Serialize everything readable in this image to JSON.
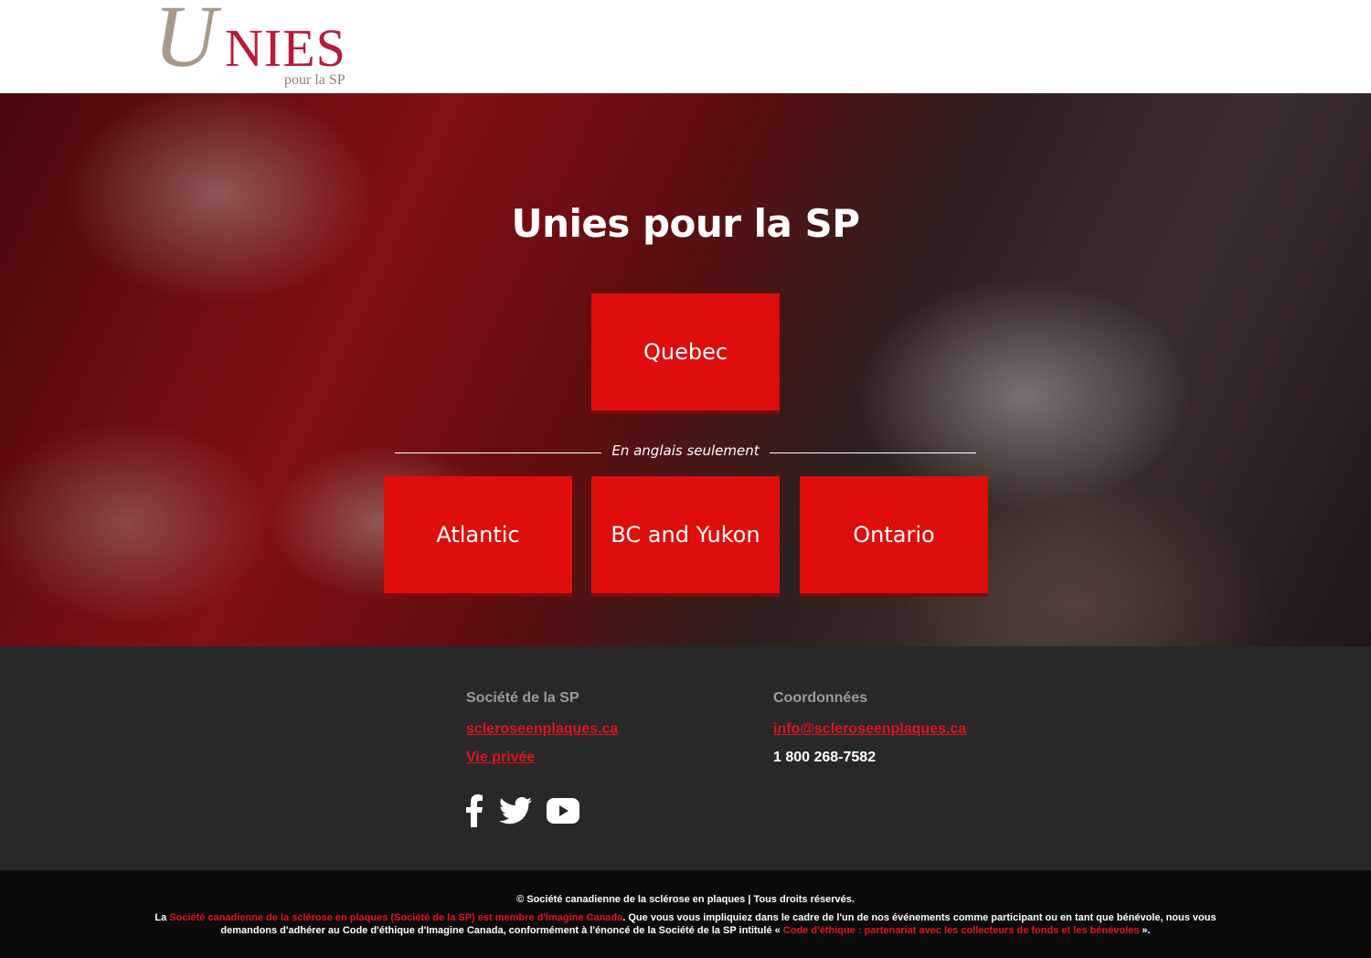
{
  "header": {
    "logo": {
      "letter": "U",
      "word": "NIES",
      "subtitle": "pour la SP"
    }
  },
  "hero": {
    "title": "Unies pour la SP",
    "primary_button": "Quebec",
    "divider_text": "En anglais seulement",
    "english_buttons": [
      "Atlantic",
      "BC and Yukon",
      "Ontario"
    ]
  },
  "footer": {
    "col1": {
      "title": "Société de la SP",
      "links": [
        "scleroseenplaques.ca",
        "Vie privée"
      ]
    },
    "col2": {
      "title": "Coordonnées",
      "email": "info@scleroseenplaques.ca",
      "phone": "1 800 268-7582"
    },
    "social": [
      "facebook-icon",
      "twitter-icon",
      "youtube-icon"
    ]
  },
  "bottom": {
    "copyright": "© Société canadienne de la sclérose en plaques | Tous droits réservés.",
    "legal_prefix": "La ",
    "legal_link1": "Société canadienne de la sclérose en plaques (Société de la SP) est membre d'Imagine Canada",
    "legal_middle": ". Que vous vous impliquiez dans le cadre de l'un de nos événements comme participant ou en tant que bénévole, nous vous demandons d'adhérer au Code d'éthique d'Imagine Canada, conformément à l'énoncé de la Société de la SP intitulé « ",
    "legal_link2": "Code d'éthique : partenariat avec les collecteurs de fonds et les bénévoles",
    "legal_suffix": " »."
  },
  "colors": {
    "accent": "#e00d0d",
    "footer_bg": "#282828",
    "bottom_bg": "#0b0b0b"
  }
}
